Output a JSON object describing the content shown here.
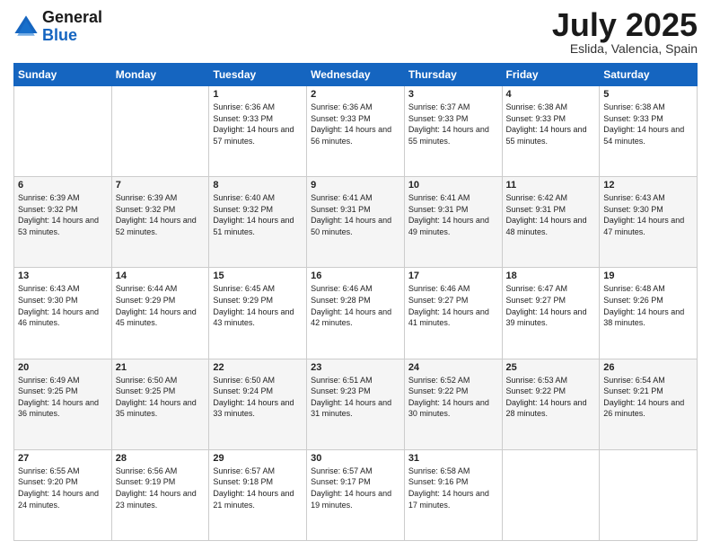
{
  "header": {
    "logo_general": "General",
    "logo_blue": "Blue",
    "title": "July 2025",
    "subtitle": "Eslida, Valencia, Spain"
  },
  "days_of_week": [
    "Sunday",
    "Monday",
    "Tuesday",
    "Wednesday",
    "Thursday",
    "Friday",
    "Saturday"
  ],
  "weeks": [
    [
      {
        "day": "",
        "sunrise": "",
        "sunset": "",
        "daylight": ""
      },
      {
        "day": "",
        "sunrise": "",
        "sunset": "",
        "daylight": ""
      },
      {
        "day": "1",
        "sunrise": "Sunrise: 6:36 AM",
        "sunset": "Sunset: 9:33 PM",
        "daylight": "Daylight: 14 hours and 57 minutes."
      },
      {
        "day": "2",
        "sunrise": "Sunrise: 6:36 AM",
        "sunset": "Sunset: 9:33 PM",
        "daylight": "Daylight: 14 hours and 56 minutes."
      },
      {
        "day": "3",
        "sunrise": "Sunrise: 6:37 AM",
        "sunset": "Sunset: 9:33 PM",
        "daylight": "Daylight: 14 hours and 55 minutes."
      },
      {
        "day": "4",
        "sunrise": "Sunrise: 6:38 AM",
        "sunset": "Sunset: 9:33 PM",
        "daylight": "Daylight: 14 hours and 55 minutes."
      },
      {
        "day": "5",
        "sunrise": "Sunrise: 6:38 AM",
        "sunset": "Sunset: 9:33 PM",
        "daylight": "Daylight: 14 hours and 54 minutes."
      }
    ],
    [
      {
        "day": "6",
        "sunrise": "Sunrise: 6:39 AM",
        "sunset": "Sunset: 9:32 PM",
        "daylight": "Daylight: 14 hours and 53 minutes."
      },
      {
        "day": "7",
        "sunrise": "Sunrise: 6:39 AM",
        "sunset": "Sunset: 9:32 PM",
        "daylight": "Daylight: 14 hours and 52 minutes."
      },
      {
        "day": "8",
        "sunrise": "Sunrise: 6:40 AM",
        "sunset": "Sunset: 9:32 PM",
        "daylight": "Daylight: 14 hours and 51 minutes."
      },
      {
        "day": "9",
        "sunrise": "Sunrise: 6:41 AM",
        "sunset": "Sunset: 9:31 PM",
        "daylight": "Daylight: 14 hours and 50 minutes."
      },
      {
        "day": "10",
        "sunrise": "Sunrise: 6:41 AM",
        "sunset": "Sunset: 9:31 PM",
        "daylight": "Daylight: 14 hours and 49 minutes."
      },
      {
        "day": "11",
        "sunrise": "Sunrise: 6:42 AM",
        "sunset": "Sunset: 9:31 PM",
        "daylight": "Daylight: 14 hours and 48 minutes."
      },
      {
        "day": "12",
        "sunrise": "Sunrise: 6:43 AM",
        "sunset": "Sunset: 9:30 PM",
        "daylight": "Daylight: 14 hours and 47 minutes."
      }
    ],
    [
      {
        "day": "13",
        "sunrise": "Sunrise: 6:43 AM",
        "sunset": "Sunset: 9:30 PM",
        "daylight": "Daylight: 14 hours and 46 minutes."
      },
      {
        "day": "14",
        "sunrise": "Sunrise: 6:44 AM",
        "sunset": "Sunset: 9:29 PM",
        "daylight": "Daylight: 14 hours and 45 minutes."
      },
      {
        "day": "15",
        "sunrise": "Sunrise: 6:45 AM",
        "sunset": "Sunset: 9:29 PM",
        "daylight": "Daylight: 14 hours and 43 minutes."
      },
      {
        "day": "16",
        "sunrise": "Sunrise: 6:46 AM",
        "sunset": "Sunset: 9:28 PM",
        "daylight": "Daylight: 14 hours and 42 minutes."
      },
      {
        "day": "17",
        "sunrise": "Sunrise: 6:46 AM",
        "sunset": "Sunset: 9:27 PM",
        "daylight": "Daylight: 14 hours and 41 minutes."
      },
      {
        "day": "18",
        "sunrise": "Sunrise: 6:47 AM",
        "sunset": "Sunset: 9:27 PM",
        "daylight": "Daylight: 14 hours and 39 minutes."
      },
      {
        "day": "19",
        "sunrise": "Sunrise: 6:48 AM",
        "sunset": "Sunset: 9:26 PM",
        "daylight": "Daylight: 14 hours and 38 minutes."
      }
    ],
    [
      {
        "day": "20",
        "sunrise": "Sunrise: 6:49 AM",
        "sunset": "Sunset: 9:25 PM",
        "daylight": "Daylight: 14 hours and 36 minutes."
      },
      {
        "day": "21",
        "sunrise": "Sunrise: 6:50 AM",
        "sunset": "Sunset: 9:25 PM",
        "daylight": "Daylight: 14 hours and 35 minutes."
      },
      {
        "day": "22",
        "sunrise": "Sunrise: 6:50 AM",
        "sunset": "Sunset: 9:24 PM",
        "daylight": "Daylight: 14 hours and 33 minutes."
      },
      {
        "day": "23",
        "sunrise": "Sunrise: 6:51 AM",
        "sunset": "Sunset: 9:23 PM",
        "daylight": "Daylight: 14 hours and 31 minutes."
      },
      {
        "day": "24",
        "sunrise": "Sunrise: 6:52 AM",
        "sunset": "Sunset: 9:22 PM",
        "daylight": "Daylight: 14 hours and 30 minutes."
      },
      {
        "day": "25",
        "sunrise": "Sunrise: 6:53 AM",
        "sunset": "Sunset: 9:22 PM",
        "daylight": "Daylight: 14 hours and 28 minutes."
      },
      {
        "day": "26",
        "sunrise": "Sunrise: 6:54 AM",
        "sunset": "Sunset: 9:21 PM",
        "daylight": "Daylight: 14 hours and 26 minutes."
      }
    ],
    [
      {
        "day": "27",
        "sunrise": "Sunrise: 6:55 AM",
        "sunset": "Sunset: 9:20 PM",
        "daylight": "Daylight: 14 hours and 24 minutes."
      },
      {
        "day": "28",
        "sunrise": "Sunrise: 6:56 AM",
        "sunset": "Sunset: 9:19 PM",
        "daylight": "Daylight: 14 hours and 23 minutes."
      },
      {
        "day": "29",
        "sunrise": "Sunrise: 6:57 AM",
        "sunset": "Sunset: 9:18 PM",
        "daylight": "Daylight: 14 hours and 21 minutes."
      },
      {
        "day": "30",
        "sunrise": "Sunrise: 6:57 AM",
        "sunset": "Sunset: 9:17 PM",
        "daylight": "Daylight: 14 hours and 19 minutes."
      },
      {
        "day": "31",
        "sunrise": "Sunrise: 6:58 AM",
        "sunset": "Sunset: 9:16 PM",
        "daylight": "Daylight: 14 hours and 17 minutes."
      },
      {
        "day": "",
        "sunrise": "",
        "sunset": "",
        "daylight": ""
      },
      {
        "day": "",
        "sunrise": "",
        "sunset": "",
        "daylight": ""
      }
    ]
  ]
}
